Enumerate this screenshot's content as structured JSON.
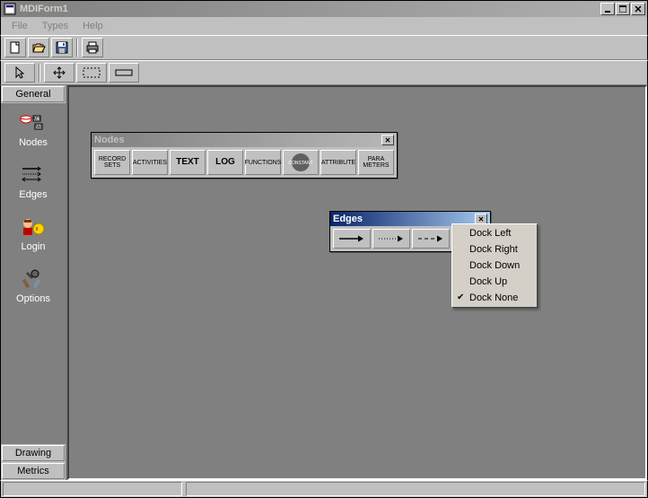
{
  "window": {
    "title": "MDIForm1"
  },
  "menu": {
    "items": [
      "File",
      "Types",
      "Help"
    ]
  },
  "sidebar": {
    "top_tab": "General",
    "items": [
      {
        "label": "Nodes"
      },
      {
        "label": "Edges"
      },
      {
        "label": "Login"
      },
      {
        "label": "Options"
      }
    ],
    "bottom_tabs": [
      "Drawing",
      "Metrics"
    ]
  },
  "nodes_toolbar": {
    "title": "Nodes",
    "buttons": [
      "RECORD SETS",
      "ACTIVITIES",
      "TEXT",
      "LOG",
      "FUNCTIONS",
      "CONSTANT",
      "ATTRIBUTE",
      "PARA METERS"
    ]
  },
  "edges_toolbar": {
    "title": "Edges"
  },
  "context_menu": {
    "items": [
      {
        "label": "Dock Left",
        "checked": false
      },
      {
        "label": "Dock Right",
        "checked": false
      },
      {
        "label": "Dock Down",
        "checked": false
      },
      {
        "label": "Dock Up",
        "checked": false
      },
      {
        "label": "Dock None",
        "checked": true
      }
    ]
  }
}
